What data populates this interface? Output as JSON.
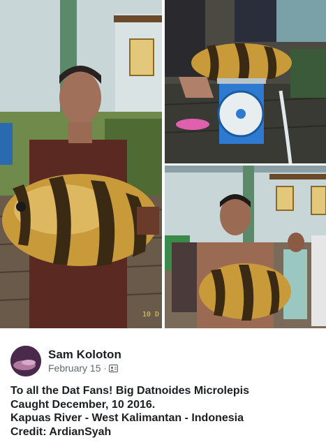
{
  "collage": {
    "date_stamp": "10 D"
  },
  "post": {
    "author": "Sam Koloton",
    "date": "February 15",
    "separator": "·",
    "privacy_icon": "friends-icon",
    "message_lines": [
      "To all the Dat Fans!  Big Datnoides Microlepis",
      "Caught December, 10 2016.",
      "Kapuas River - West Kalimantan - Indonesia",
      "Credit: ArdianSyah"
    ]
  },
  "colors": {
    "text_primary": "#1c1e21",
    "text_secondary": "#606770",
    "fish_gold": "#c99a3a",
    "fish_stripe": "#3a2a14"
  }
}
